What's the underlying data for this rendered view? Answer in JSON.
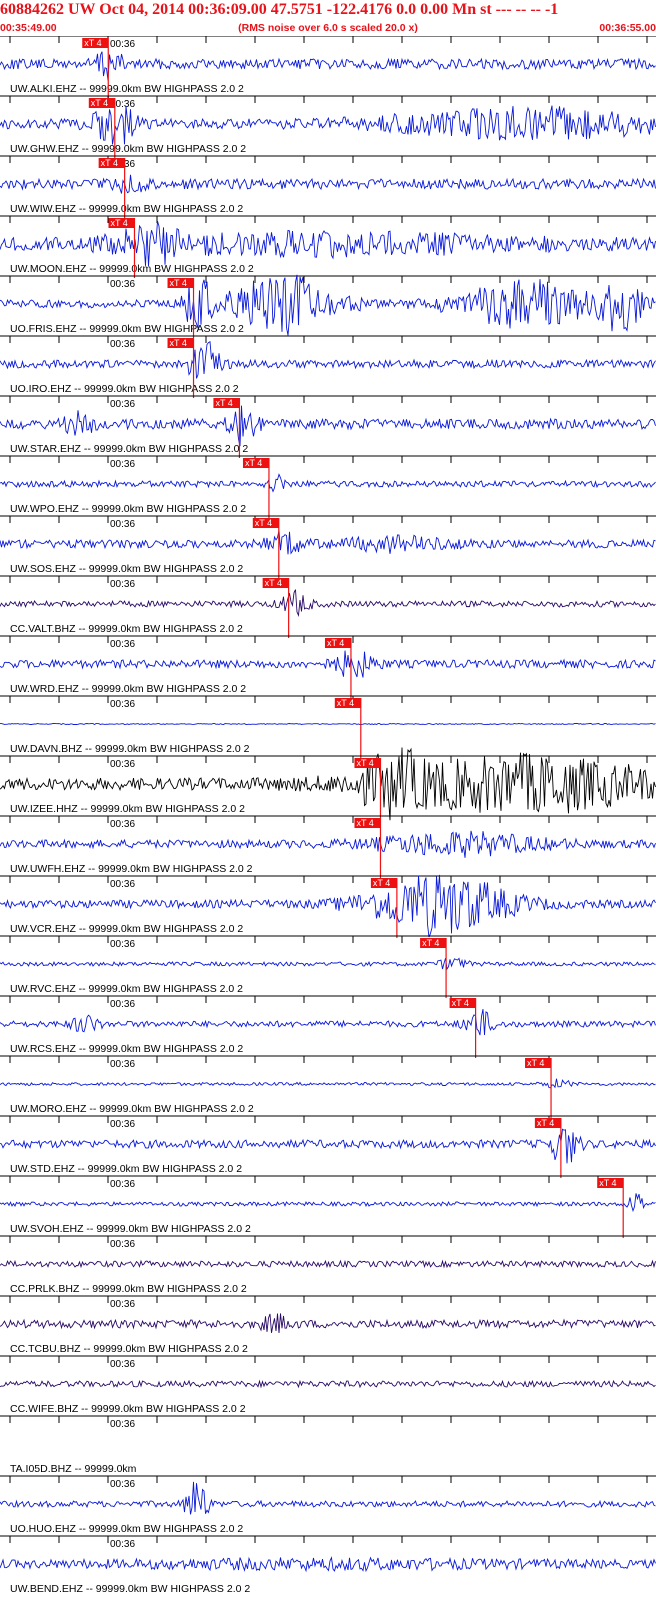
{
  "header": {
    "title": "60884262 UW Oct 04, 2014 00:36:09.00   47.5751 -122.4176  0.0 0.00 Mn st --- -- --  -1",
    "start_time": "00:35:49.00",
    "note": "(RMS noise over 6.0 s scaled 20.0 x)",
    "end_time": "00:36:55.00"
  },
  "colors": {
    "header_text": "#e8121a",
    "trace_blue": "#0a19d8",
    "trace_purple": "#2a0a66",
    "trace_black": "#000000",
    "pick_fill": "#ee1111",
    "pick_text": "#ffffff"
  },
  "tick_label": "00:36",
  "traces": [
    {
      "label": "UW.ALKI.EHZ -- 99999.0km BW  HIGHPASS  2.0  2",
      "color": "blue",
      "pick": 0.165,
      "pick_label": "xT 4",
      "amp": 5,
      "bursts": [
        [
          0.165,
          0.02,
          14
        ]
      ]
    },
    {
      "label": "UW.GHW.EHZ -- 99999.0km BW  HIGHPASS  2.0  2",
      "color": "blue",
      "pick": 0.175,
      "pick_label": "xT 4",
      "amp": 5,
      "bursts": [
        [
          0.175,
          0.03,
          20
        ],
        [
          0.8,
          0.2,
          14
        ]
      ]
    },
    {
      "label": "UW.WIW.EHZ -- 99999.0km BW  HIGHPASS  2.0  2",
      "color": "blue",
      "pick": 0.19,
      "pick_label": "xT 4",
      "amp": 5,
      "bursts": [
        [
          0.2,
          0.02,
          8
        ]
      ]
    },
    {
      "label": "UW.MOON.EHZ -- 99999.0km BW  HIGHPASS  2.0  2",
      "color": "blue",
      "pick": 0.205,
      "pick_label": "xT 4",
      "amp": 6,
      "bursts": [
        [
          0.23,
          0.05,
          14
        ],
        [
          0.5,
          0.3,
          8
        ]
      ]
    },
    {
      "label": "UO.FRIS.EHZ -- 99999.0km BW  HIGHPASS  2.0  2",
      "color": "blue",
      "pick": 0.295,
      "pick_label": "xT 4",
      "amp": 4,
      "bursts": [
        [
          0.3,
          0.02,
          28
        ],
        [
          0.43,
          0.08,
          28
        ],
        [
          0.8,
          0.1,
          22
        ],
        [
          0.95,
          0.03,
          28
        ]
      ]
    },
    {
      "label": "UO.IRO.EHZ -- 99999.0km BW  HIGHPASS  2.0  2",
      "color": "blue",
      "pick": 0.295,
      "pick_label": "xT 4",
      "amp": 4,
      "bursts": [
        [
          0.31,
          0.02,
          28
        ]
      ]
    },
    {
      "label": "UW.STAR.EHZ -- 99999.0km BW  HIGHPASS  2.0  2",
      "color": "blue",
      "pick": 0.365,
      "pick_label": "xT 4",
      "amp": 5,
      "bursts": [
        [
          0.37,
          0.02,
          20
        ],
        [
          0.12,
          0.02,
          10
        ]
      ]
    },
    {
      "label": "UW.WPO.EHZ -- 99999.0km BW  HIGHPASS  2.0  2",
      "color": "blue",
      "pick": 0.41,
      "pick_label": "xT 4",
      "amp": 3,
      "bursts": [
        [
          0.42,
          0.01,
          10
        ]
      ]
    },
    {
      "label": "UW.SOS.EHZ -- 99999.0km BW  HIGHPASS  2.0  2",
      "color": "blue",
      "pick": 0.425,
      "pick_label": "xT 4",
      "amp": 4,
      "bursts": [
        [
          0.43,
          0.03,
          10
        ],
        [
          0.6,
          0.08,
          6
        ]
      ]
    },
    {
      "label": "CC.VALT.BHZ -- 99999.0km BW  HIGHPASS  2.0  2",
      "color": "purple",
      "pick": 0.44,
      "pick_label": "xT 4",
      "amp": 3,
      "bursts": [
        [
          0.45,
          0.02,
          12
        ]
      ]
    },
    {
      "label": "UW.WRD.EHZ -- 99999.0km BW  HIGHPASS  2.0  2",
      "color": "blue",
      "pick": 0.535,
      "pick_label": "xT 4",
      "amp": 4,
      "bursts": [
        [
          0.54,
          0.03,
          12
        ]
      ]
    },
    {
      "label": "UW.DAVN.BHZ -- 99999.0km BW  HIGHPASS  2.0  2",
      "color": "blue",
      "pick": 0.55,
      "pick_label": "xT 4",
      "amp": 0.5,
      "bursts": []
    },
    {
      "label": "UW.IZEE.HHZ -- 99999.0km BW  HIGHPASS  2.0  2",
      "color": "black",
      "pick": 0.58,
      "pick_label": "xT 4",
      "amp": 6,
      "bursts": [
        [
          0.6,
          0.05,
          22
        ],
        [
          0.8,
          0.2,
          26
        ]
      ]
    },
    {
      "label": "UW.UWFH.EHZ -- 99999.0km BW  HIGHPASS  2.0  2",
      "color": "blue",
      "pick": 0.58,
      "pick_label": "xT 4",
      "amp": 4,
      "bursts": [
        [
          0.7,
          0.12,
          10
        ]
      ]
    },
    {
      "label": "UW.VCR.EHZ -- 99999.0km BW  HIGHPASS  2.0  2",
      "color": "blue",
      "pick": 0.605,
      "pick_label": "xT 4",
      "amp": 4,
      "bursts": [
        [
          0.67,
          0.1,
          30
        ]
      ]
    },
    {
      "label": "UW.RVC.EHZ -- 99999.0km BW  HIGHPASS  2.0  2",
      "color": "blue",
      "pick": 0.68,
      "pick_label": "xT 4",
      "amp": 2,
      "bursts": [
        [
          0.69,
          0.02,
          6
        ]
      ]
    },
    {
      "label": "UW.RCS.EHZ -- 99999.0km BW  HIGHPASS  2.0  2",
      "color": "blue",
      "pick": 0.725,
      "pick_label": "xT 4",
      "amp": 3,
      "bursts": [
        [
          0.73,
          0.02,
          14
        ],
        [
          0.13,
          0.02,
          8
        ]
      ]
    },
    {
      "label": "UW.MORO.EHZ -- 99999.0km BW  HIGHPASS  2.0  2",
      "color": "blue",
      "pick": 0.84,
      "pick_label": "xT 4",
      "amp": 1.5,
      "bursts": [
        [
          0.85,
          0.02,
          4
        ]
      ]
    },
    {
      "label": "UW.STD.EHZ -- 99999.0km BW  HIGHPASS  2.0  2",
      "color": "blue",
      "pick": 0.855,
      "pick_label": "xT 4",
      "amp": 4,
      "bursts": [
        [
          0.86,
          0.02,
          20
        ]
      ]
    },
    {
      "label": "UW.SVOH.EHZ -- 99999.0km BW  HIGHPASS  2.0  2",
      "color": "blue",
      "pick": 0.95,
      "pick_label": "xT 4",
      "amp": 2,
      "bursts": [
        [
          0.97,
          0.01,
          14
        ]
      ]
    },
    {
      "label": "CC.PRLK.BHZ -- 99999.0km BW  HIGHPASS  2.0  2",
      "color": "purple",
      "amp": 3,
      "bursts": []
    },
    {
      "label": "CC.TCBU.BHZ -- 99999.0km BW  HIGHPASS  2.0  2",
      "color": "purple",
      "amp": 4,
      "bursts": [
        [
          0.42,
          0.02,
          8
        ]
      ]
    },
    {
      "label": "CC.WIFE.BHZ -- 99999.0km BW  HIGHPASS  2.0  2",
      "color": "purple",
      "amp": 3,
      "bursts": []
    },
    {
      "label": "TA.I05D.BHZ -- 99999.0km",
      "color": "blue",
      "amp": 0,
      "bursts": []
    },
    {
      "label": "UO.HUO.EHZ -- 99999.0km BW  HIGHPASS  2.0  2",
      "color": "blue",
      "amp": 3,
      "bursts": [
        [
          0.3,
          0.015,
          26
        ]
      ]
    },
    {
      "label": "UW.BEND.EHZ -- 99999.0km BW  HIGHPASS  2.0  2",
      "color": "blue",
      "amp": 4,
      "bursts": [
        [
          0.5,
          0.3,
          3
        ]
      ]
    }
  ]
}
